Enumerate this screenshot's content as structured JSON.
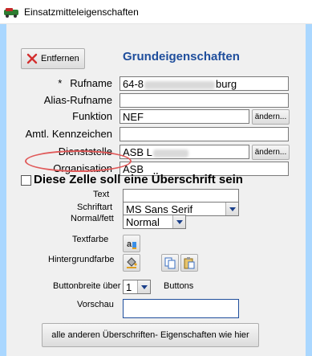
{
  "window": {
    "title": "Einsatzmitteleigenschaften"
  },
  "toolbar": {
    "delete_label": "Entfernen"
  },
  "section": {
    "heading": "Grundeigenschaften"
  },
  "fields": {
    "rufname": {
      "required_mark": "*",
      "label": "Rufname",
      "value_prefix": "64-8",
      "value_suffix": "burg"
    },
    "alias": {
      "label": "Alias-Rufname",
      "value": ""
    },
    "funktion": {
      "label": "Funktion",
      "value": "NEF",
      "button": "ändern..."
    },
    "kennzeichen": {
      "label": "Amtl. Kennzeichen",
      "value": ""
    },
    "dienststelle": {
      "label": "Dienststelle",
      "value_prefix": "ASB L",
      "button": "ändern..."
    },
    "organisation": {
      "label": "Organisation",
      "value": "ASB"
    }
  },
  "heading_cell": {
    "checked": false,
    "label": "Diese Zelle soll eine Überschrift sein"
  },
  "format": {
    "text_label": "Text",
    "text_value": "",
    "font_label": "Schriftart",
    "font_value": "MS Sans Serif",
    "style_label": "Normal/fett",
    "style_value": "Normal",
    "textcolor_label": "Textfarbe",
    "bgcolor_label": "Hintergrundfarbe",
    "buttonwidth_label": "Buttonbreite über",
    "buttonwidth_value": "1",
    "buttonwidth_unit": "Buttons",
    "preview_label": "Vorschau",
    "preview_value": ""
  },
  "footer": {
    "apply_all_label": "alle anderen Überschriften- Eigenschaften wie hier"
  },
  "colors": {
    "heading": "#1f4e9c",
    "highlight_ring": "#e05a5a",
    "frame": "#aad7ff",
    "pane": "#f0f0f0"
  }
}
